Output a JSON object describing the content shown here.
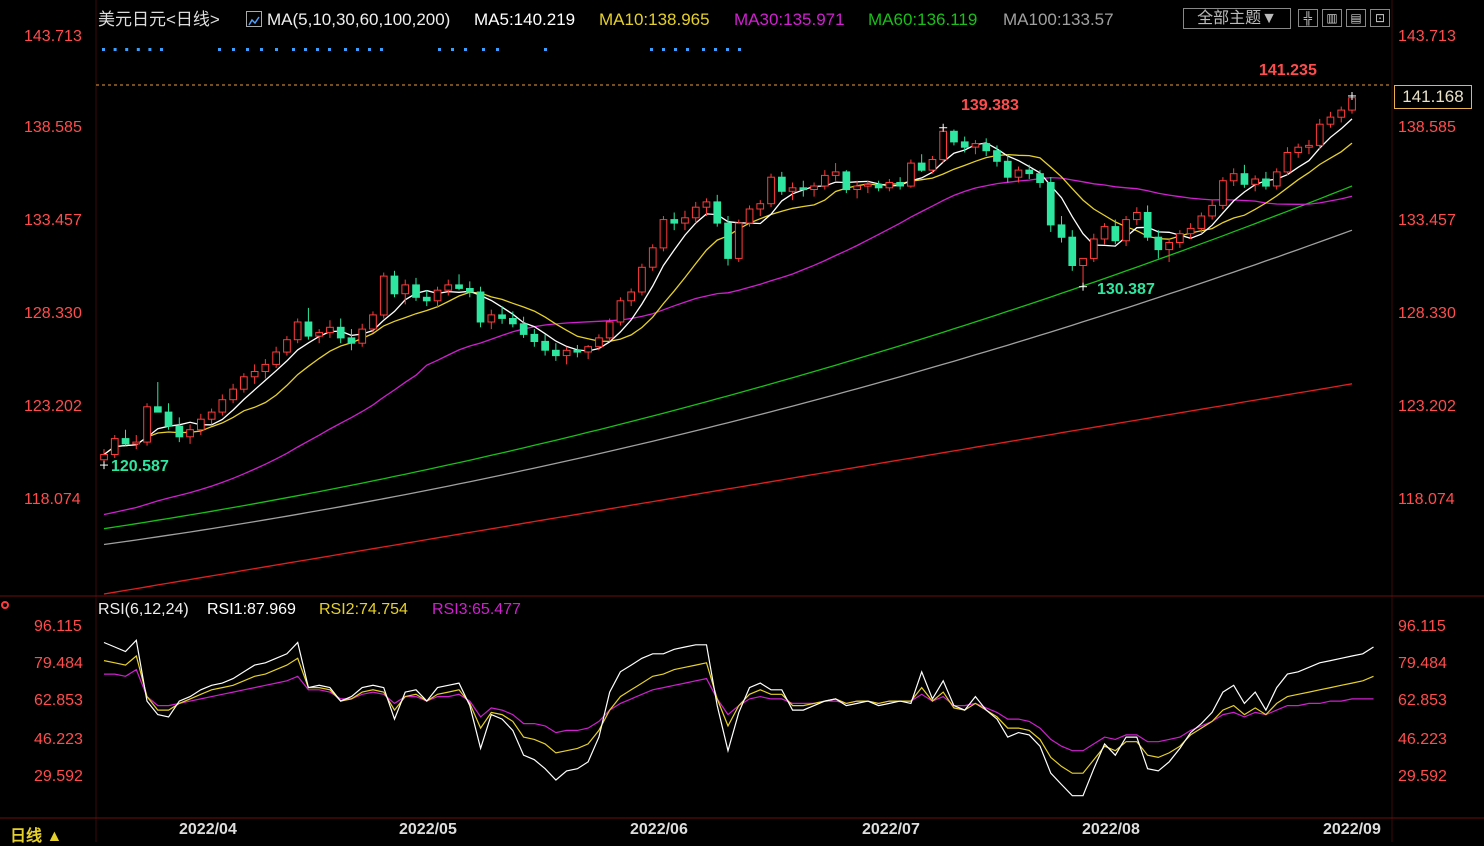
{
  "header": {
    "title": "美元日元<日线>",
    "indicator": "MA(5,10,30,60,100,200)",
    "ma5": "MA5:140.219",
    "ma10": "MA10:138.965",
    "ma30": "MA30:135.971",
    "ma60": "MA60:136.119",
    "ma100": "MA100:133.57",
    "theme_button": "全部主题▼",
    "tool_icons": [
      "crosshair-icon",
      "layout-grid-icon",
      "chart-type-icon",
      "exit-fullscreen-icon"
    ]
  },
  "price_axis": {
    "labels": [
      "143.713",
      "138.585",
      "133.457",
      "128.330",
      "123.202",
      "118.074"
    ],
    "current": "141.168"
  },
  "annotations": {
    "high": "141.235",
    "peak": "139.383",
    "low_aug": "130.387",
    "low_mar": "120.587"
  },
  "rsi": {
    "indicator": "RSI(6,12,24)",
    "rsi1": "RSI1:87.969",
    "rsi2": "RSI2:74.754",
    "rsi3": "RSI3:65.477",
    "axis_labels": [
      "96.115",
      "79.484",
      "62.853",
      "46.223",
      "29.592"
    ]
  },
  "dates": [
    "2022/04",
    "2022/05",
    "2022/06",
    "2022/07",
    "2022/08",
    "2022/09"
  ],
  "period_tab": "日线 ▲",
  "colors": {
    "up": "#ff3b3b",
    "down": "#2ee6a0",
    "ma5": "#ffffff",
    "ma10": "#e6d02a",
    "ma30": "#d020d0",
    "ma60": "#18c018",
    "ma100": "#a0a0a0",
    "ma200": "#e02020",
    "axis_text": "#ff4d4d",
    "rsi_axis_text": "#ff4d4d"
  },
  "chart_data": {
    "type": "candlestick",
    "price_range": [
      113.0,
      145.5
    ],
    "rsi_range": [
      13.0,
      100.0
    ],
    "candles": [
      [
        120.6,
        121.2,
        120.3,
        120.9
      ],
      [
        120.9,
        122.0,
        120.7,
        121.8
      ],
      [
        121.8,
        122.3,
        121.4,
        121.5
      ],
      [
        121.5,
        122.0,
        121.2,
        121.6
      ],
      [
        121.6,
        123.8,
        121.4,
        123.6
      ],
      [
        123.6,
        125.0,
        123.3,
        123.3
      ],
      [
        123.3,
        123.8,
        122.3,
        122.5
      ],
      [
        122.5,
        123.0,
        121.6,
        121.9
      ],
      [
        121.9,
        122.6,
        121.5,
        122.3
      ],
      [
        122.3,
        123.2,
        122.0,
        122.9
      ],
      [
        122.9,
        123.5,
        122.6,
        123.3
      ],
      [
        123.3,
        124.3,
        123.1,
        124.0
      ],
      [
        124.0,
        124.9,
        123.8,
        124.6
      ],
      [
        124.6,
        125.5,
        124.4,
        125.3
      ],
      [
        125.3,
        126.0,
        124.9,
        125.6
      ],
      [
        125.6,
        126.3,
        125.2,
        126.0
      ],
      [
        126.0,
        127.0,
        125.8,
        126.7
      ],
      [
        126.7,
        127.6,
        126.5,
        127.4
      ],
      [
        127.4,
        128.6,
        127.2,
        128.4
      ],
      [
        128.4,
        129.2,
        127.4,
        127.6
      ],
      [
        127.6,
        128.0,
        127.2,
        127.8
      ],
      [
        127.8,
        128.5,
        127.5,
        128.1
      ],
      [
        128.1,
        128.6,
        127.2,
        127.5
      ],
      [
        127.5,
        128.0,
        126.8,
        127.2
      ],
      [
        127.2,
        128.3,
        127.0,
        128.0
      ],
      [
        128.0,
        129.0,
        127.8,
        128.8
      ],
      [
        128.8,
        131.2,
        128.6,
        131.0
      ],
      [
        131.0,
        131.3,
        129.8,
        130.0
      ],
      [
        130.0,
        130.8,
        129.4,
        130.5
      ],
      [
        130.5,
        130.9,
        129.6,
        129.8
      ],
      [
        129.8,
        130.2,
        129.3,
        129.6
      ],
      [
        129.6,
        130.4,
        129.2,
        130.2
      ],
      [
        130.2,
        130.8,
        129.9,
        130.5
      ],
      [
        130.5,
        131.1,
        130.2,
        130.3
      ],
      [
        130.3,
        130.7,
        129.8,
        130.1
      ],
      [
        130.1,
        130.4,
        128.1,
        128.4
      ],
      [
        128.4,
        129.1,
        128.0,
        128.8
      ],
      [
        128.8,
        129.3,
        128.3,
        128.6
      ],
      [
        128.6,
        129.0,
        128.1,
        128.3
      ],
      [
        128.3,
        128.7,
        127.5,
        127.7
      ],
      [
        127.7,
        128.0,
        127.0,
        127.3
      ],
      [
        127.3,
        127.7,
        126.5,
        126.8
      ],
      [
        126.8,
        127.2,
        126.2,
        126.5
      ],
      [
        126.5,
        127.0,
        126.0,
        126.8
      ],
      [
        126.8,
        127.1,
        126.4,
        126.7
      ],
      [
        126.7,
        127.1,
        126.3,
        127.0
      ],
      [
        127.0,
        127.7,
        126.8,
        127.5
      ],
      [
        127.5,
        128.6,
        127.3,
        128.4
      ],
      [
        128.4,
        129.8,
        128.2,
        129.6
      ],
      [
        129.6,
        130.3,
        129.3,
        130.1
      ],
      [
        130.1,
        131.7,
        129.9,
        131.5
      ],
      [
        131.5,
        132.8,
        131.3,
        132.6
      ],
      [
        132.6,
        134.4,
        132.4,
        134.2
      ],
      [
        134.2,
        134.6,
        133.6,
        134.0
      ],
      [
        134.0,
        134.7,
        133.6,
        134.3
      ],
      [
        134.3,
        135.2,
        134.0,
        134.9
      ],
      [
        134.9,
        135.4,
        134.4,
        135.2
      ],
      [
        135.2,
        135.6,
        133.8,
        134.0
      ],
      [
        134.0,
        134.4,
        131.6,
        132.0
      ],
      [
        132.0,
        134.2,
        131.8,
        134.0
      ],
      [
        134.0,
        135.0,
        133.8,
        134.8
      ],
      [
        134.8,
        135.3,
        134.4,
        135.1
      ],
      [
        135.1,
        136.8,
        134.9,
        136.6
      ],
      [
        136.6,
        136.9,
        135.6,
        135.8
      ],
      [
        135.8,
        136.3,
        135.3,
        136.0
      ],
      [
        136.0,
        136.4,
        135.5,
        135.9
      ],
      [
        135.9,
        136.3,
        135.5,
        136.1
      ],
      [
        136.1,
        137.0,
        135.9,
        136.7
      ],
      [
        136.7,
        137.4,
        136.4,
        136.9
      ],
      [
        136.9,
        137.0,
        135.7,
        135.9
      ],
      [
        135.9,
        136.4,
        135.4,
        136.1
      ],
      [
        136.1,
        136.4,
        135.7,
        136.2
      ],
      [
        136.2,
        136.4,
        135.8,
        136.0
      ],
      [
        136.0,
        136.5,
        135.8,
        136.3
      ],
      [
        136.3,
        136.6,
        135.9,
        136.1
      ],
      [
        136.1,
        137.6,
        136.0,
        137.4
      ],
      [
        137.4,
        137.9,
        136.9,
        137.0
      ],
      [
        137.0,
        137.8,
        136.8,
        137.6
      ],
      [
        137.6,
        139.4,
        137.4,
        139.2
      ],
      [
        139.2,
        139.3,
        138.4,
        138.6
      ],
      [
        138.6,
        138.9,
        138.0,
        138.3
      ],
      [
        138.3,
        138.7,
        137.9,
        138.5
      ],
      [
        138.5,
        138.8,
        137.8,
        138.1
      ],
      [
        138.1,
        138.4,
        137.2,
        137.5
      ],
      [
        137.5,
        137.9,
        136.3,
        136.6
      ],
      [
        136.6,
        137.2,
        136.3,
        137.0
      ],
      [
        137.0,
        137.3,
        136.5,
        136.8
      ],
      [
        136.8,
        137.0,
        136.0,
        136.3
      ],
      [
        136.3,
        136.6,
        133.5,
        133.9
      ],
      [
        133.9,
        134.4,
        132.9,
        133.2
      ],
      [
        133.2,
        133.6,
        131.3,
        131.6
      ],
      [
        131.6,
        132.0,
        130.4,
        132.0
      ],
      [
        132.0,
        133.4,
        131.8,
        133.1
      ],
      [
        133.1,
        134.0,
        132.8,
        133.8
      ],
      [
        133.8,
        134.2,
        132.8,
        133.0
      ],
      [
        133.0,
        134.4,
        132.7,
        134.2
      ],
      [
        134.2,
        134.9,
        133.9,
        134.6
      ],
      [
        134.6,
        135.0,
        133.0,
        133.2
      ],
      [
        133.2,
        133.6,
        132.0,
        132.5
      ],
      [
        132.5,
        133.1,
        131.8,
        132.9
      ],
      [
        132.9,
        133.6,
        132.6,
        133.4
      ],
      [
        133.4,
        134.0,
        133.1,
        133.7
      ],
      [
        133.7,
        134.6,
        133.4,
        134.4
      ],
      [
        134.4,
        135.3,
        134.2,
        135.0
      ],
      [
        135.0,
        136.6,
        134.8,
        136.4
      ],
      [
        136.4,
        137.1,
        136.1,
        136.8
      ],
      [
        136.8,
        137.3,
        136.0,
        136.2
      ],
      [
        136.2,
        136.7,
        135.8,
        136.5
      ],
      [
        136.5,
        136.9,
        135.9,
        136.1
      ],
      [
        136.1,
        137.1,
        135.9,
        136.9
      ],
      [
        136.9,
        138.3,
        136.7,
        138.0
      ],
      [
        138.0,
        138.5,
        137.7,
        138.3
      ],
      [
        138.3,
        138.7,
        137.9,
        138.4
      ],
      [
        138.4,
        139.9,
        138.2,
        139.6
      ],
      [
        139.6,
        140.3,
        139.4,
        140.0
      ],
      [
        140.0,
        140.6,
        139.7,
        140.4
      ],
      [
        140.4,
        141.2,
        140.2,
        141.1
      ]
    ],
    "rsi1": [
      90,
      88,
      86,
      91,
      64,
      58,
      57,
      64,
      66,
      69,
      71,
      72,
      74,
      77,
      80,
      81,
      83,
      85,
      90,
      70,
      71,
      70,
      64,
      66,
      70,
      71,
      70,
      56,
      68,
      69,
      64,
      70,
      71,
      72,
      62,
      43,
      58,
      56,
      51,
      40,
      38,
      34,
      29,
      33,
      34,
      37,
      48,
      68,
      77,
      80,
      83,
      85,
      85,
      87,
      88,
      89,
      89,
      62,
      42,
      59,
      70,
      72,
      69,
      69,
      60,
      60,
      62,
      64,
      65,
      62,
      63,
      64,
      62,
      63,
      64,
      63,
      77,
      65,
      73,
      62,
      60,
      66,
      60,
      56,
      48,
      50,
      49,
      44,
      32,
      27,
      22,
      22,
      34,
      45,
      40,
      48,
      48,
      34,
      33,
      37,
      43,
      50,
      54,
      59,
      68,
      71,
      63,
      68,
      60,
      70,
      76,
      77,
      79,
      81,
      82,
      83,
      84,
      85,
      88
    ],
    "rsi2": [
      82,
      81,
      80,
      84,
      66,
      60,
      60,
      63,
      65,
      67,
      69,
      70,
      71,
      73,
      75,
      76,
      78,
      80,
      83,
      70,
      70,
      69,
      64,
      65,
      68,
      69,
      68,
      60,
      66,
      67,
      64,
      67,
      68,
      69,
      63,
      52,
      59,
      58,
      55,
      48,
      47,
      45,
      41,
      42,
      43,
      45,
      51,
      60,
      66,
      69,
      72,
      75,
      76,
      78,
      79,
      80,
      81,
      65,
      53,
      62,
      67,
      69,
      67,
      67,
      62,
      62,
      63,
      64,
      65,
      63,
      64,
      64,
      63,
      64,
      64,
      64,
      70,
      64,
      68,
      61,
      60,
      63,
      60,
      57,
      52,
      52,
      51,
      47,
      39,
      35,
      32,
      32,
      38,
      44,
      42,
      46,
      46,
      40,
      39,
      41,
      44,
      49,
      52,
      55,
      60,
      62,
      58,
      61,
      58,
      63,
      66,
      67,
      68,
      69,
      70,
      71,
      72,
      73,
      75
    ],
    "rsi3": [
      76,
      76,
      75,
      78,
      66,
      62,
      62,
      63,
      64,
      65,
      66,
      67,
      68,
      69,
      70,
      71,
      72,
      73,
      75,
      69,
      69,
      68,
      65,
      65,
      67,
      68,
      67,
      63,
      66,
      66,
      64,
      66,
      66,
      67,
      64,
      57,
      61,
      60,
      58,
      54,
      54,
      53,
      50,
      51,
      51,
      52,
      55,
      60,
      63,
      65,
      67,
      69,
      70,
      71,
      72,
      73,
      74,
      65,
      58,
      62,
      65,
      66,
      65,
      65,
      63,
      63,
      63,
      64,
      64,
      63,
      64,
      64,
      63,
      64,
      64,
      64,
      67,
      64,
      66,
      62,
      62,
      63,
      61,
      59,
      56,
      56,
      55,
      52,
      47,
      44,
      42,
      42,
      45,
      48,
      47,
      49,
      49,
      46,
      46,
      47,
      48,
      51,
      53,
      55,
      58,
      59,
      57,
      59,
      58,
      60,
      62,
      62,
      63,
      63,
      64,
      64,
      65,
      65,
      65
    ]
  }
}
